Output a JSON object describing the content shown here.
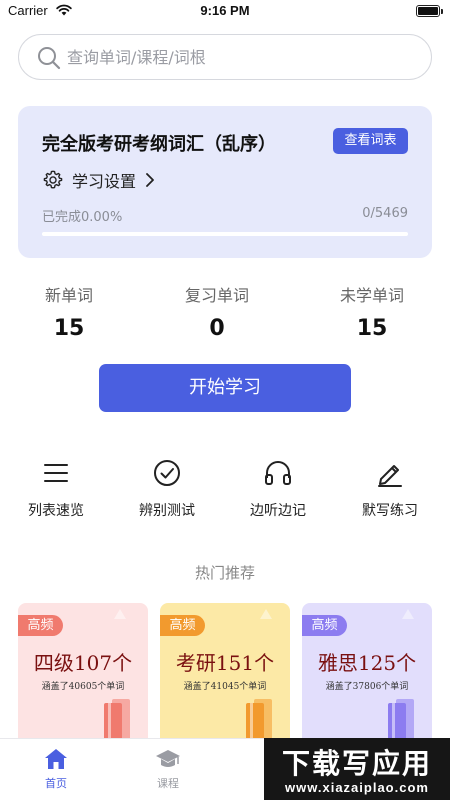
{
  "status_bar": {
    "carrier": "Carrier",
    "time": "9:16 PM"
  },
  "search": {
    "placeholder": "查询单词/课程/词根"
  },
  "course": {
    "title": "完全版考研考纲词汇（乱序）",
    "wordlist_button": "查看词表",
    "settings_label": "学习设置",
    "progress_text": "已完成0.00%",
    "progress_count": "0/5469",
    "progress_fraction": 0.0
  },
  "stats": [
    {
      "label": "新单词",
      "value": "15"
    },
    {
      "label": "复习单词",
      "value": "0"
    },
    {
      "label": "未学单词",
      "value": "15"
    }
  ],
  "start_button": "开始学习",
  "tools": [
    {
      "label": "列表速览",
      "icon": "list-icon"
    },
    {
      "label": "辨别测试",
      "icon": "check-circle-icon"
    },
    {
      "label": "边听边记",
      "icon": "headphones-icon"
    },
    {
      "label": "默写练习",
      "icon": "pen-icon"
    }
  ],
  "recommend": {
    "title": "热门推荐",
    "cards": [
      {
        "badge": "高频",
        "name": "四级107个",
        "subtitle": "涵盖了40605个单词",
        "bg": "#fde3e3",
        "badge_color": "#f07a6e",
        "book_color": "#f07a6e"
      },
      {
        "badge": "高频",
        "name": "考研151个",
        "subtitle": "涵盖了41045个单词",
        "bg": "#fce9a6",
        "badge_color": "#f29a2e",
        "book_color": "#f29a2e"
      },
      {
        "badge": "高频",
        "name": "雅思125个",
        "subtitle": "涵盖了37806个单词",
        "bg": "#e2defc",
        "badge_color": "#8c7cf0",
        "book_color": "#8c7cf0"
      }
    ]
  },
  "tabbar": {
    "tabs": [
      {
        "label": "首页",
        "icon": "home-icon",
        "active": true
      },
      {
        "label": "课程",
        "icon": "graduation-cap-icon",
        "active": false
      }
    ]
  },
  "watermark": {
    "main": "下载写应用",
    "sub": "www.xiazaiplao.com"
  },
  "colors": {
    "accent": "#4a5fe0",
    "card_bg": "#e6e9fb",
    "muted": "#8a8d96"
  }
}
